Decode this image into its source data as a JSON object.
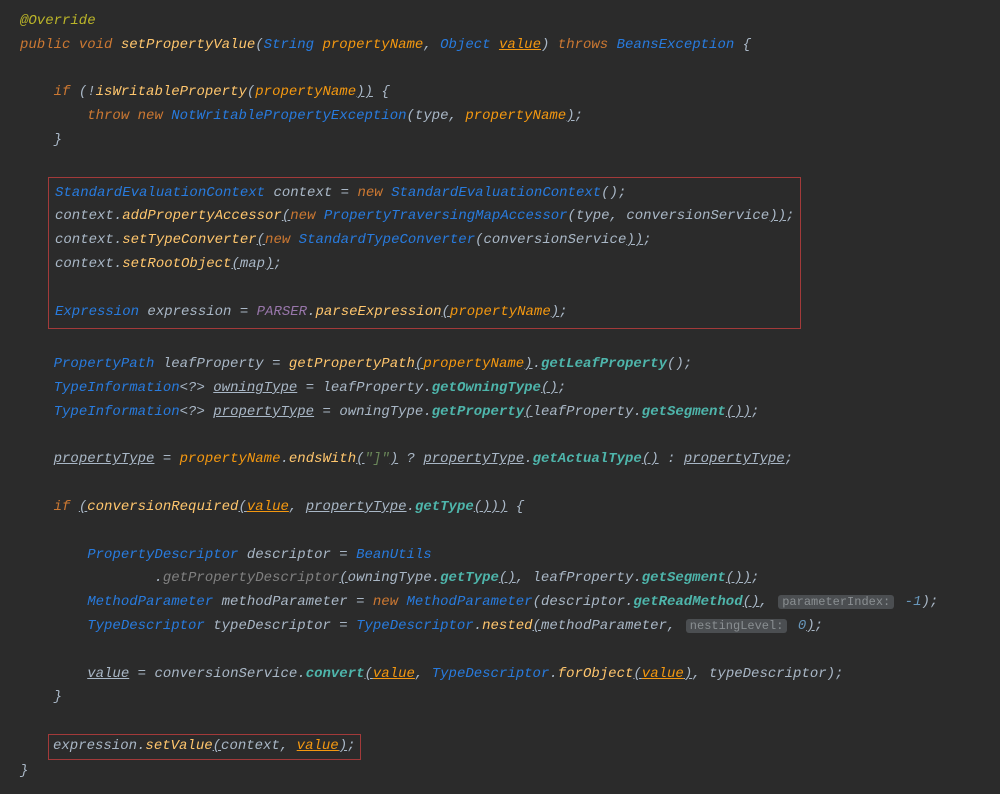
{
  "t": {
    "ann": "@Override",
    "kw_public": "public",
    "kw_void": "void",
    "kw_if": "if",
    "kw_throw": "throw",
    "kw_new": "new",
    "kw_throws": "throws",
    "m_name": "setPropertyValue",
    "ty_String": "String",
    "ty_Object": "Object",
    "ty_BeansException": "BeansException",
    "p_propertyName": "propertyName",
    "p_value": "value",
    "m_isWritableProperty": "isWritableProperty",
    "ty_NotWritablePropertyException": "NotWritableProperty Exception",
    "NotWritable": "NotWritablePropertyException",
    "v_type": "type",
    "ty_SEC": "StandardEvaluationContext",
    "v_context": "context",
    "m_addPA": "addPropertyAccessor",
    "ty_PTMA": "PropertyTraversingMapAccessor",
    "v_conversionService": "conversionService",
    "m_setTypeConverter": "setTypeConverter",
    "ty_STC": "StandardTypeConverter",
    "m_setRootObject": "setRootObject",
    "v_map": "map",
    "ty_Expression": "Expression",
    "v_expression": "expression",
    "c_PARSER": "PARSER",
    "m_parseExpression": "parseExpression",
    "ty_PropertyPath": "PropertyPath",
    "v_leafProperty": "leafProperty",
    "m_getPropertyPath": "getPropertyPath",
    "m_getLeafProperty": "getLeafProperty",
    "ty_TypeInformation": "TypeInformation",
    "gen": "<?>",
    "v_owningType": "owningType",
    "m_getOwningType": "getOwningType",
    "v_propertyType": "propertyType",
    "m_getProperty": "getProperty",
    "m_getSegment": "getSegment",
    "m_endsWith": "endsWith",
    "str_brackets": "\"]\"",
    "m_getActualType": "getActualType",
    "m_conversionRequired": "conversionRequired",
    "m_getType": "getType",
    "ty_PD": "PropertyDescriptor",
    "v_descriptor": "descriptor",
    "ty_BeanUtils": "BeanUtils",
    "m_getPDgrey": "getPropertyDescriptor",
    "ty_MP": "MethodParameter",
    "v_methodParameter": "methodParameter",
    "m_getReadMethod": "getReadMethod",
    "hint_paramIndex": "parameterIndex:",
    "lit_minus1": "-1",
    "ty_TD": "TypeDescriptor",
    "v_typeDescriptor": "typeDescriptor",
    "m_nested": "nested",
    "hint_nesting": "nestingLevel:",
    "lit_0": "0",
    "m_convert": "convert",
    "m_forObject": "forObject",
    "m_setValue": "setValue"
  }
}
